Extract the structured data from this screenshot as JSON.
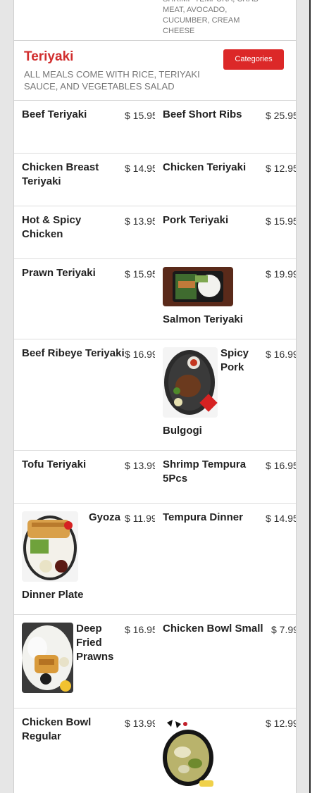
{
  "previous_category": {
    "description_tail": "SHRIMP TEMPURA, CRAB MEAT, AVOCADO, CUCUMBER, CREAM CHEESE"
  },
  "category": {
    "title": "Teriyaki",
    "description": "ALL MEALS COME WITH RICE, TERIYAKI SAUCE, AND VEGETABLES SALAD",
    "categories_button": "Categories"
  },
  "items": [
    {
      "name": "Beef Teriyaki",
      "price": "$ 15.95"
    },
    {
      "name": "Beef Short Ribs",
      "price": "$ 25.95"
    },
    {
      "name": "Chicken Breast Teriyaki",
      "price": "$ 14.95"
    },
    {
      "name": "Chicken Teriyaki",
      "price": "$ 12.95"
    },
    {
      "name": "Hot & Spicy Chicken",
      "price": "$ 13.95"
    },
    {
      "name": "Pork Teriyaki",
      "price": "$ 15.95"
    },
    {
      "name": "Prawn Teriyaki",
      "price": "$ 15.95"
    },
    {
      "name": "Salmon Teriyaki",
      "price": "$ 19.99",
      "image": "salmon-teriyaki-photo"
    },
    {
      "name": "Beef Ribeye Teriyaki",
      "price": "$ 16.99"
    },
    {
      "name_a": "Spicy",
      "name_b": "Pork",
      "name_c": "Bulgogi",
      "price": "$ 16.99",
      "image": "spicy-pork-bulgogi-photo"
    },
    {
      "name": "Tofu Teriyaki",
      "price": "$ 13.99"
    },
    {
      "name": "Shrimp Tempura 5Pcs",
      "price": "$ 16.95"
    },
    {
      "name_a": "Gyoza",
      "name_b": "Dinner Plate",
      "price": "$ 11.99",
      "image": "gyoza-dinner-plate-photo"
    },
    {
      "name": "Tempura Dinner",
      "price": "$ 14.95"
    },
    {
      "name_a": "Deep",
      "name_b": "Fried",
      "name_c": "Prawns",
      "price": "$ 16.95",
      "image": "deep-fried-prawns-photo"
    },
    {
      "name": "Chicken Bowl Small",
      "price": "$ 7.99"
    },
    {
      "name": "Chicken Bowl Regular",
      "price": "$ 13.99"
    },
    {
      "name": "",
      "price": "$ 12.99",
      "image": "stir-fry-bowl-photo"
    }
  ]
}
